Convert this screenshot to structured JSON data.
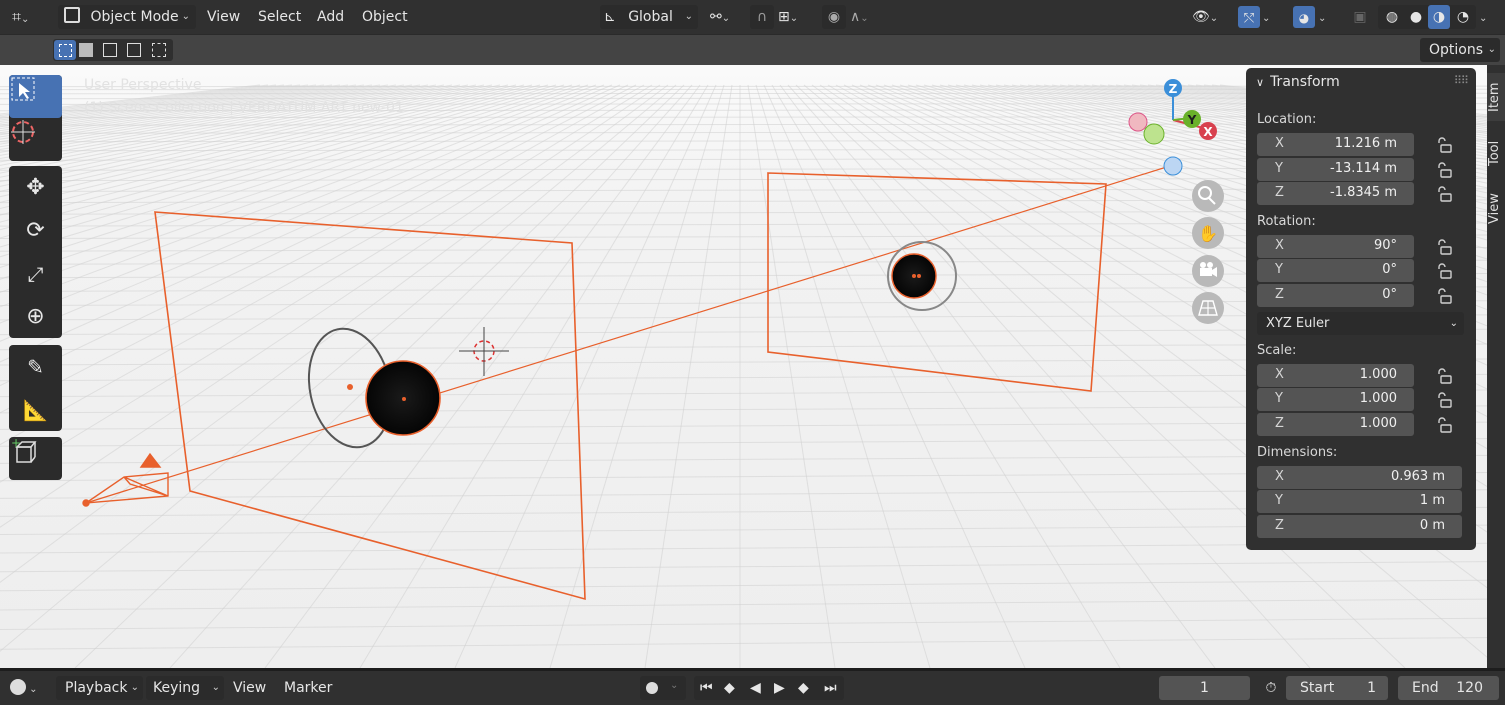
{
  "header": {
    "mode": "Object Mode",
    "menus": [
      "View",
      "Select",
      "Add",
      "Object"
    ],
    "orientation": "Global"
  },
  "toolrow": {
    "options_label": "Options"
  },
  "viewport": {
    "perspective_label": "User Perspective",
    "collection_label": "(1) Scene Collection | VERDATUM ART new-01",
    "gizmo_axes": {
      "x": "X",
      "y": "Y",
      "z": "Z"
    }
  },
  "tabs": [
    "Item",
    "Tool",
    "View"
  ],
  "transform": {
    "title": "Transform",
    "location_label": "Location:",
    "location": [
      {
        "axis": "X",
        "value": "11.216 m"
      },
      {
        "axis": "Y",
        "value": "-13.114 m"
      },
      {
        "axis": "Z",
        "value": "-1.8345 m"
      }
    ],
    "rotation_label": "Rotation:",
    "rotation": [
      {
        "axis": "X",
        "value": "90°"
      },
      {
        "axis": "Y",
        "value": "0°"
      },
      {
        "axis": "Z",
        "value": "0°"
      }
    ],
    "rotation_mode": "XYZ Euler",
    "scale_label": "Scale:",
    "scale": [
      {
        "axis": "X",
        "value": "1.000"
      },
      {
        "axis": "Y",
        "value": "1.000"
      },
      {
        "axis": "Z",
        "value": "1.000"
      }
    ],
    "dimensions_label": "Dimensions:",
    "dimensions": [
      {
        "axis": "X",
        "value": "0.963 m"
      },
      {
        "axis": "Y",
        "value": "1 m"
      },
      {
        "axis": "Z",
        "value": "0 m"
      }
    ]
  },
  "timeline": {
    "menus": {
      "playback": "Playback",
      "keying": "Keying",
      "view": "View",
      "marker": "Marker"
    },
    "current_frame": "1",
    "start_label": "Start",
    "start": "1",
    "end_label": "End",
    "end": "120"
  },
  "colors": {
    "accent": "#4772b3",
    "selection": "#e8602c",
    "header_bg": "#303030",
    "viewport_bg": "#f3f3f3"
  }
}
